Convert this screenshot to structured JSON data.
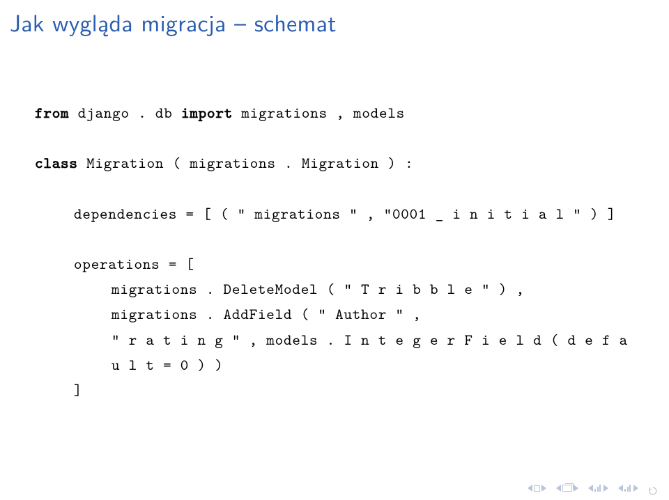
{
  "title": "Jak wygląda migracja – schemat",
  "code": {
    "kw_from": "from",
    "module": " django . db ",
    "kw_import": "import",
    "imports": " migrations , models",
    "kw_class": "class",
    "classdef": " Migration ( migrations . Migration ) :",
    "deps": "dependencies = [ ( \" migrations \" , \"0001 _ i n i t i a l \" ) ]",
    "ops_open": "operations = [",
    "op1": "migrations . DeleteModel ( \" T r i b b l e \" ) ,",
    "op2": "migrations . AddField ( \" Author \" ,",
    "op3": "\" r a t i n g \" , models . I n t e g e r F i e l d ( d e f a u l t = 0 ) )",
    "ops_close": "]"
  }
}
